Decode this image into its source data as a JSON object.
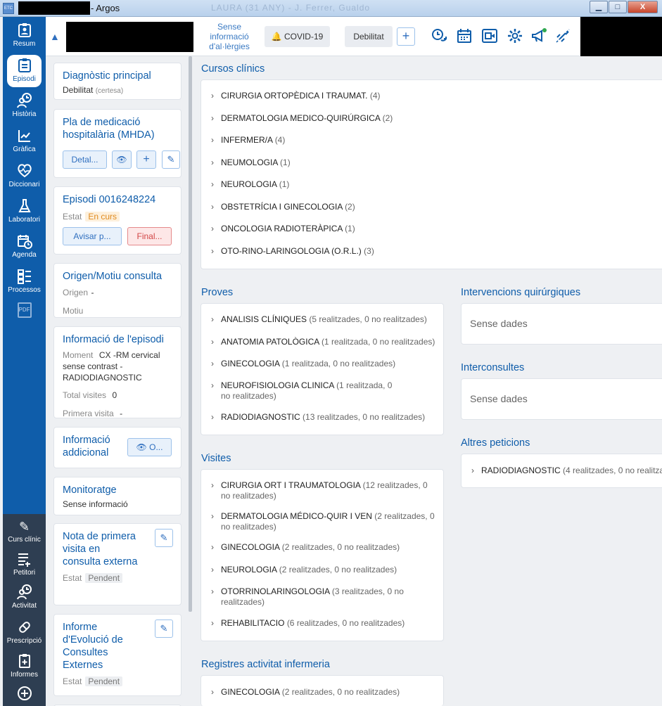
{
  "window": {
    "title": "- Argos",
    "icon_label": "ETC",
    "ghost_text": "LAURA (31 ANY) - J. Ferrer, Gualdo",
    "min": "▁",
    "max": "□",
    "close": "X"
  },
  "nav": [
    {
      "label": "Resum",
      "icon": "user-card-icon"
    },
    {
      "label": "Episodi",
      "icon": "clipboard-icon",
      "active": true
    },
    {
      "label": "Història",
      "icon": "history-icon"
    },
    {
      "label": "Gràfica",
      "icon": "chart-icon"
    },
    {
      "label": "Diccionari",
      "icon": "heartbeat-icon"
    },
    {
      "label": "Laboratori",
      "icon": "flask-icon"
    },
    {
      "label": "Agenda",
      "icon": "calendar-clock-icon"
    },
    {
      "label": "Processos",
      "icon": "process-icon"
    },
    {
      "label": "",
      "icon": "pdf-icon"
    }
  ],
  "nav_bottom": [
    {
      "label": "Curs clínic",
      "icon": "pencil-icon"
    },
    {
      "label": "Petitori",
      "icon": "list-add-icon"
    },
    {
      "label": "Activitat",
      "icon": "activity-icon"
    },
    {
      "label": "Prescripció",
      "icon": "pill-icon"
    },
    {
      "label": "Informes",
      "icon": "report-icon"
    },
    {
      "label": "",
      "icon": "plus-circle-icon"
    }
  ],
  "nav_pdf_label": "PDF",
  "header": {
    "allergy": "Sense informació d'al·lèrgies",
    "covid": "COVID-19",
    "debilitat": "Debilitat",
    "plus": "+"
  },
  "cards": {
    "diag": {
      "title": "Diagnòstic principal",
      "value": "Debilitat",
      "certainty": "(certesa)"
    },
    "mhda": {
      "title": "Pla de medicació hospitalària (MHDA)",
      "detail_btn": "Detal..."
    },
    "episode": {
      "title": "Episodi 0016248224",
      "state_label": "Estat",
      "state": "En curs",
      "notify_btn": "Avisar p...",
      "final_btn": "Final..."
    },
    "origin": {
      "title": "Origen/Motiu consulta",
      "origin_label": "Origen",
      "origin_value": "-",
      "motiu_label": "Motiu"
    },
    "info": {
      "title": "Informació de l'episodi",
      "moment_label": "Moment",
      "moment_value": "CX -RM cervical sense contrast - RADIODIAGNOSTIC",
      "visits_label": "Total visites",
      "visits_value": "0",
      "first_label": "Primera visita",
      "first_value": "-"
    },
    "extra": {
      "title": "Informació addicional",
      "btn": "O..."
    },
    "monitor": {
      "title": "Monitoratge",
      "value": "Sense informació"
    },
    "nota": {
      "title": "Nota de primera visita en consulta externa",
      "state_label": "Estat",
      "state": "Pendent"
    },
    "informe": {
      "title": "Informe d'Evolució de Consultes Externes",
      "state_label": "Estat",
      "state": "Pendent"
    }
  },
  "cursos": {
    "title": "Cursos clínics",
    "items": [
      {
        "name": "CIRURGIA ORTOPÈDICA I TRAUMAT.",
        "count": "(4)"
      },
      {
        "name": "DERMATOLOGIA MEDICO-QUIRÚRGICA",
        "count": "(2)"
      },
      {
        "name": "INFERMER/A",
        "count": "(4)"
      },
      {
        "name": "NEUMOLOGIA",
        "count": "(1)"
      },
      {
        "name": "NEUROLOGIA",
        "count": "(1)"
      },
      {
        "name": "OBSTETRÍCIA I GINECOLOGIA",
        "count": "(2)"
      },
      {
        "name": "ONCOLOGIA RADIOTERÀPICA",
        "count": "(1)"
      },
      {
        "name": "OTO-RINO-LARINGOLOGIA (O.R.L.)",
        "count": "(3)"
      }
    ]
  },
  "proves": {
    "title": "Proves",
    "items": [
      {
        "name": "ANALISIS CLÍNIQUES",
        "count": "(5 realitzades, 0 no realitzades)"
      },
      {
        "name": "ANATOMIA PATOLÒGICA",
        "count": "(1 realitzada, 0 no realitzades)"
      },
      {
        "name": "GINECOLOGIA",
        "count": "(1 realitzada, 0 no realitzades)"
      },
      {
        "name": "NEUROFISIOLOGIA CLINICA",
        "count": "(1 realitzada, 0 no realitzades)"
      },
      {
        "name": "RADIODIAGNOSTIC",
        "count": "(13 realitzades, 0 no realitzades)"
      }
    ]
  },
  "visites": {
    "title": "Visites",
    "items": [
      {
        "name": "CIRURGIA ORT I TRAUMATOLOGIA",
        "count": "(12 realitzades, 0 no realitzades)"
      },
      {
        "name": "DERMATOLOGIA MÉDICO-QUIR I VEN",
        "count": "(2 realitzades, 0 no realitzades)"
      },
      {
        "name": "GINECOLOGIA",
        "count": "(2 realitzades, 0 no realitzades)"
      },
      {
        "name": "NEUROLOGIA",
        "count": "(2 realitzades, 0 no realitzades)"
      },
      {
        "name": "OTORRINOLARINGOLOGIA",
        "count": "(3 realitzades, 0 no realitzades)"
      },
      {
        "name": "REHABILITACIO",
        "count": "(6 realitzades, 0 no realitzades)"
      }
    ]
  },
  "registres": {
    "title": "Registres activitat infermeria",
    "items": [
      {
        "name": "GINECOLOGIA",
        "count": "(2 realitzades, 0 no realitzades)"
      }
    ]
  },
  "intervencions": {
    "title": "Intervencions quirúrgiques",
    "empty": "Sense dades"
  },
  "interconsultes": {
    "title": "Interconsultes",
    "empty": "Sense dades"
  },
  "altres": {
    "title": "Altres peticions",
    "items": [
      {
        "name": "RADIODIAGNOSTIC",
        "count": "(4 realitzades, 0 no realitza"
      }
    ]
  },
  "colors": {
    "brand": "#0f5daa",
    "nav_bottom": "#2e3e52",
    "badge_orange": "#e08a1e",
    "danger": "#d24646"
  }
}
